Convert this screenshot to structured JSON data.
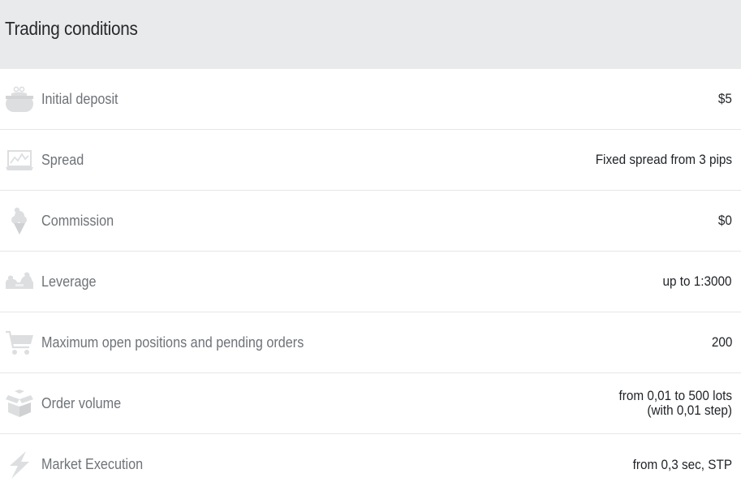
{
  "header": {
    "title": "Trading conditions"
  },
  "colors": {
    "header_bg": "#e9eaeb",
    "icon": "#dcdee0",
    "label": "#6e7378",
    "value": "#1f2226",
    "divider": "#e6e7e8"
  },
  "rows": [
    {
      "icon": "wallet-icon",
      "label": "Initial deposit",
      "value": "$5"
    },
    {
      "icon": "laptop-chart-icon",
      "label": "Spread",
      "value": "Fixed spread from 3 pips"
    },
    {
      "icon": "ice-cream-icon",
      "label": "Commission",
      "value": "$0"
    },
    {
      "icon": "flexed-arm-icon",
      "label": "Leverage",
      "value": "up to 1:3000"
    },
    {
      "icon": "shopping-cart-icon",
      "label": "Maximum open positions and pending orders",
      "value": "200"
    },
    {
      "icon": "open-box-icon",
      "label": "Order volume",
      "value_line1": "from 0,01 to 500 lots",
      "value_line2": "(with 0,01 step)"
    },
    {
      "icon": "lightning-icon",
      "label": "Market Execution",
      "value": "from 0,3 sec, STP"
    }
  ]
}
